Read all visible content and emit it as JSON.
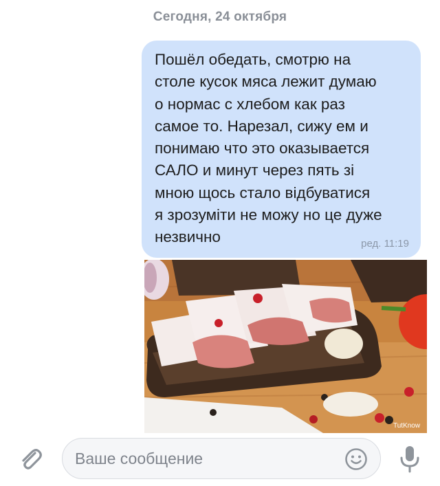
{
  "chat": {
    "date_separator": "Сегодня, 24 октября",
    "message": {
      "lines": [
        "Пошёл обедать, смотрю на",
        "столе кусок мяса лежит думаю",
        "о нормас с хлебом как раз",
        "самое то. Нарезал, сижу ем и",
        "понимаю что это оказывается",
        "САЛО и минут через пять зі",
        "мною щось стало відбуватися",
        "я зрозуміти не можу но це дуже",
        "незвично"
      ],
      "meta": "ред. 11:19",
      "bubble_color": "#d0e2fb"
    },
    "photo": {
      "description_icon": "photo-salo-on-bread",
      "watermark": "TutKnow"
    }
  },
  "composer": {
    "placeholder": "Ваше сообщение",
    "attach_icon": "paperclip-icon",
    "emoji_icon": "smile-icon",
    "mic_icon": "microphone-icon"
  }
}
